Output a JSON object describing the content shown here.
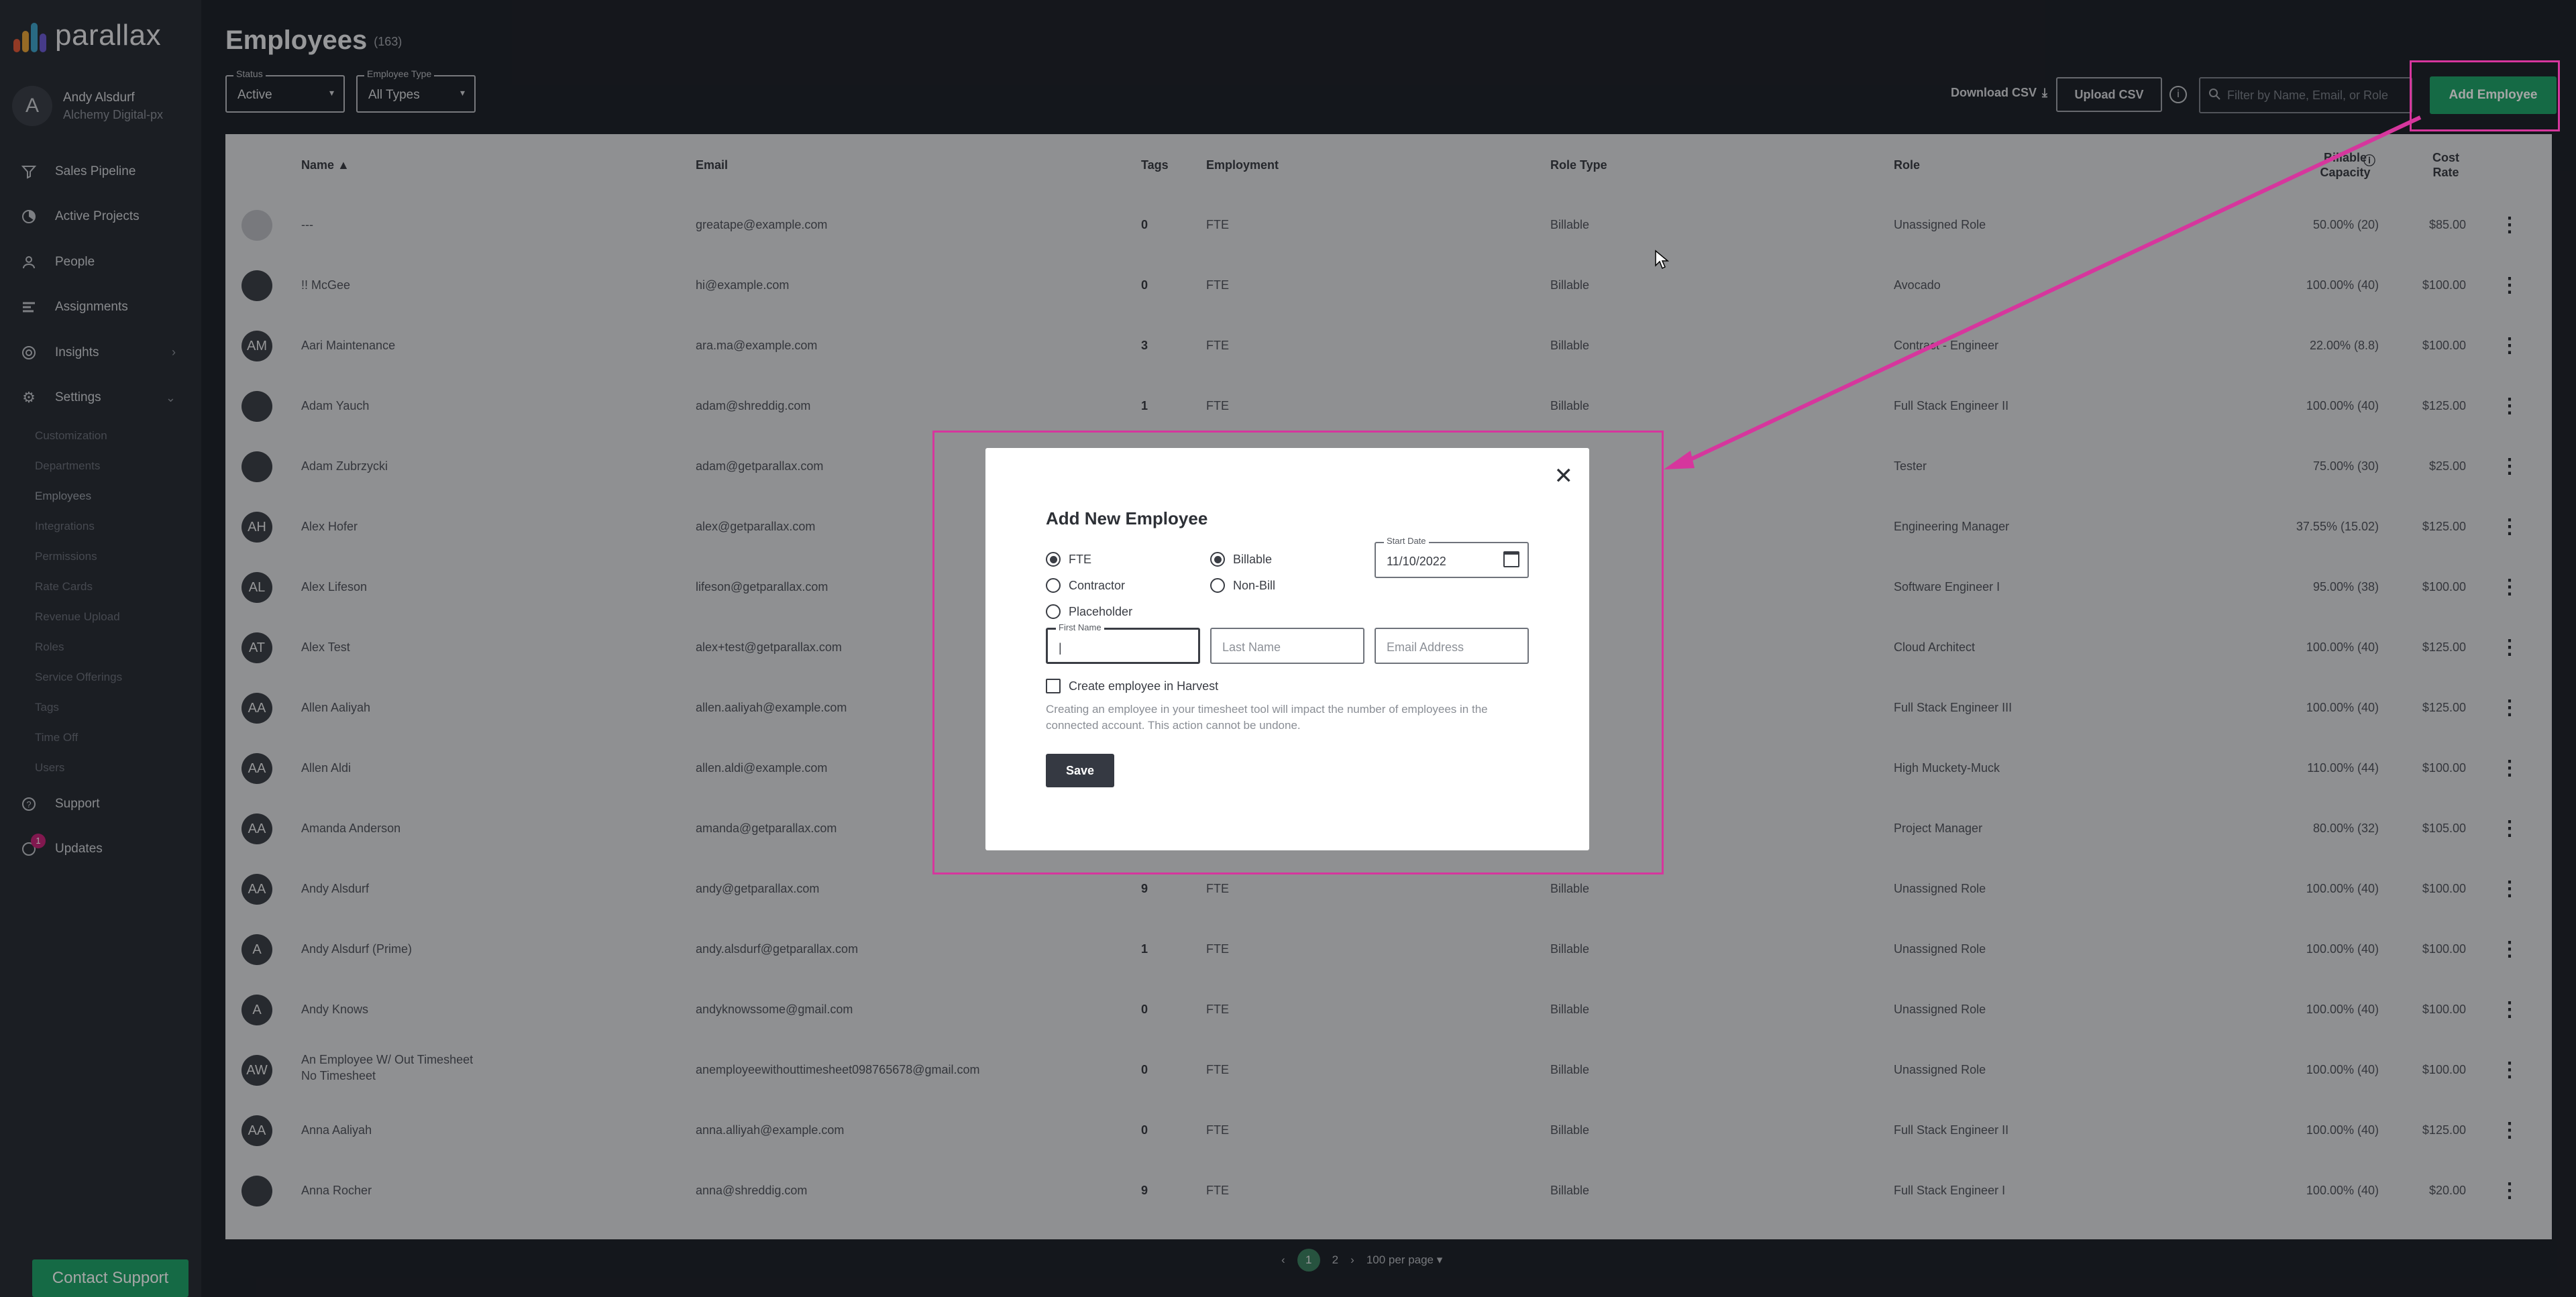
{
  "sidebar": {
    "logo": "parallax",
    "user_initial": "A",
    "user_name": "Andy Alsdurf",
    "user_org": "Alchemy Digital-px",
    "nav": [
      {
        "label": "Sales Pipeline",
        "icon": "funnel-icon"
      },
      {
        "label": "Active Projects",
        "icon": "active-projects-icon"
      },
      {
        "label": "People",
        "icon": "person-icon"
      },
      {
        "label": "Assignments",
        "icon": "assignments-icon"
      },
      {
        "label": "Insights",
        "icon": "insights-icon"
      },
      {
        "label": "Settings",
        "icon": "gear-icon"
      }
    ],
    "settings_subnav": [
      "Customization",
      "Departments",
      "Employees",
      "Integrations",
      "Permissions",
      "Rate Cards",
      "Revenue Upload",
      "Roles",
      "Service Offerings",
      "Tags",
      "Time Off",
      "Users"
    ],
    "support": "Support",
    "updates": "Updates",
    "updates_badge": "1",
    "contact_support": "Contact Support"
  },
  "header": {
    "title": "Employees",
    "count": "(163)",
    "status_label": "Status",
    "status_value": "Active",
    "type_label": "Employee Type",
    "type_value": "All Types",
    "download_csv": "Download CSV",
    "upload_csv": "Upload CSV",
    "search_placeholder": "Filter by Name, Email, or Role",
    "add_employee": "Add Employee"
  },
  "table": {
    "columns": {
      "name": "Name",
      "email": "Email",
      "tags": "Tags",
      "employment": "Employment",
      "role_type": "Role Type",
      "role": "Role",
      "billable_capacity": "Billable Capacity",
      "cost_rate": "Cost Rate"
    },
    "rows": [
      {
        "initials": "",
        "name": "---",
        "email": "greatape@example.com",
        "tags": "0",
        "employment": "FTE",
        "role_type": "Billable",
        "role": "Unassigned Role",
        "capacity": "50.00% (20)",
        "rate": "$85.00"
      },
      {
        "initials": "",
        "name": "!! McGee",
        "email": "hi@example.com",
        "tags": "0",
        "employment": "FTE",
        "role_type": "Billable",
        "role": "Avocado",
        "capacity": "100.00% (40)",
        "rate": "$100.00"
      },
      {
        "initials": "AM",
        "name": "Aari Maintenance",
        "email": "ara.ma@example.com",
        "tags": "3",
        "employment": "FTE",
        "role_type": "Billable",
        "role": "Contract - Engineer",
        "capacity": "22.00% (8.8)",
        "rate": "$100.00"
      },
      {
        "initials": "",
        "name": "Adam Yauch",
        "email": "adam@shreddig.com",
        "tags": "1",
        "employment": "FTE",
        "role_type": "Billable",
        "role": "Full Stack Engineer II",
        "capacity": "100.00% (40)",
        "rate": "$125.00"
      },
      {
        "initials": "",
        "name": "Adam Zubrzycki",
        "email": "adam@getparallax.com",
        "tags": "",
        "employment": "",
        "role_type": "Billable",
        "role": "Tester",
        "capacity": "75.00% (30)",
        "rate": "$25.00"
      },
      {
        "initials": "AH",
        "name": "Alex Hofer",
        "email": "alex@getparallax.com",
        "tags": "",
        "employment": "",
        "role_type": "",
        "role": "Engineering Manager",
        "capacity": "37.55% (15.02)",
        "rate": "$125.00"
      },
      {
        "initials": "AL",
        "name": "Alex Lifeson",
        "email": "lifeson@getparallax.com",
        "tags": "",
        "employment": "",
        "role_type": "",
        "role": "Software Engineer I",
        "capacity": "95.00% (38)",
        "rate": "$100.00"
      },
      {
        "initials": "AT",
        "name": "Alex Test",
        "email": "alex+test@getparallax.com",
        "tags": "",
        "employment": "",
        "role_type": "",
        "role": "Cloud Architect",
        "capacity": "100.00% (40)",
        "rate": "$125.00"
      },
      {
        "initials": "AA",
        "name": "Allen Aaliyah",
        "email": "allen.aaliyah@example.com",
        "tags": "",
        "employment": "",
        "role_type": "",
        "role": "Full Stack Engineer III",
        "capacity": "100.00% (40)",
        "rate": "$125.00"
      },
      {
        "initials": "AA",
        "name": "Allen Aldi",
        "email": "allen.aldi@example.com",
        "tags": "",
        "employment": "",
        "role_type": "",
        "role": "High Muckety-Muck",
        "capacity": "110.00% (44)",
        "rate": "$100.00"
      },
      {
        "initials": "AA",
        "name": "Amanda Anderson",
        "email": "amanda@getparallax.com",
        "tags": "",
        "employment": "",
        "role_type": "",
        "role": "Project Manager",
        "capacity": "80.00% (32)",
        "rate": "$105.00"
      },
      {
        "initials": "AA",
        "name": "Andy Alsdurf",
        "email": "andy@getparallax.com",
        "tags": "9",
        "employment": "FTE",
        "role_type": "Billable",
        "role": "Unassigned Role",
        "capacity": "100.00% (40)",
        "rate": "$100.00"
      },
      {
        "initials": "A",
        "name": "Andy Alsdurf (Prime)",
        "email": "andy.alsdurf@getparallax.com",
        "tags": "1",
        "employment": "FTE",
        "role_type": "Billable",
        "role": "Unassigned Role",
        "capacity": "100.00% (40)",
        "rate": "$100.00"
      },
      {
        "initials": "A",
        "name": "Andy Knows",
        "email": "andyknowssome@gmail.com",
        "tags": "0",
        "employment": "FTE",
        "role_type": "Billable",
        "role": "Unassigned Role",
        "capacity": "100.00% (40)",
        "rate": "$100.00"
      },
      {
        "initials": "AW",
        "name": "An Employee W/ Out Timesheet",
        "name2": "No Timesheet",
        "email": "anemployeewithouttimesheet098765678@gmail.com",
        "tags": "0",
        "employment": "FTE",
        "role_type": "Billable",
        "role": "Unassigned Role",
        "capacity": "100.00% (40)",
        "rate": "$100.00"
      },
      {
        "initials": "AA",
        "name": "Anna Aaliyah",
        "email": "anna.alliyah@example.com",
        "tags": "0",
        "employment": "FTE",
        "role_type": "Billable",
        "role": "Full Stack Engineer II",
        "capacity": "100.00% (40)",
        "rate": "$125.00"
      },
      {
        "initials": "",
        "name": "Anna Rocher",
        "email": "anna@shreddig.com",
        "tags": "9",
        "employment": "FTE",
        "role_type": "Billable",
        "role": "Full Stack Engineer I",
        "capacity": "100.00% (40)",
        "rate": "$20.00"
      }
    ]
  },
  "pagination": {
    "page1": "1",
    "page2": "2",
    "per_page": "100 per page"
  },
  "modal": {
    "title": "Add New Employee",
    "emp_type": [
      "FTE",
      "Contractor",
      "Placeholder"
    ],
    "bill_type": [
      "Billable",
      "Non-Bill"
    ],
    "start_date_label": "Start Date",
    "start_date_value": "11/10/2022",
    "first_name_label": "First Name",
    "last_name_placeholder": "Last Name",
    "email_placeholder": "Email Address",
    "harvest_checkbox": "Create employee in Harvest",
    "help_text": "Creating an employee in your timesheet tool will impact the number of employees in the connected account. This action cannot be undone.",
    "save": "Save",
    "close_icon": "close-icon"
  },
  "colors": {
    "accent": "#21a36a",
    "highlight": "#d6369d",
    "sidebar_bg": "#2a2e36",
    "page_bg": "#20242b"
  }
}
